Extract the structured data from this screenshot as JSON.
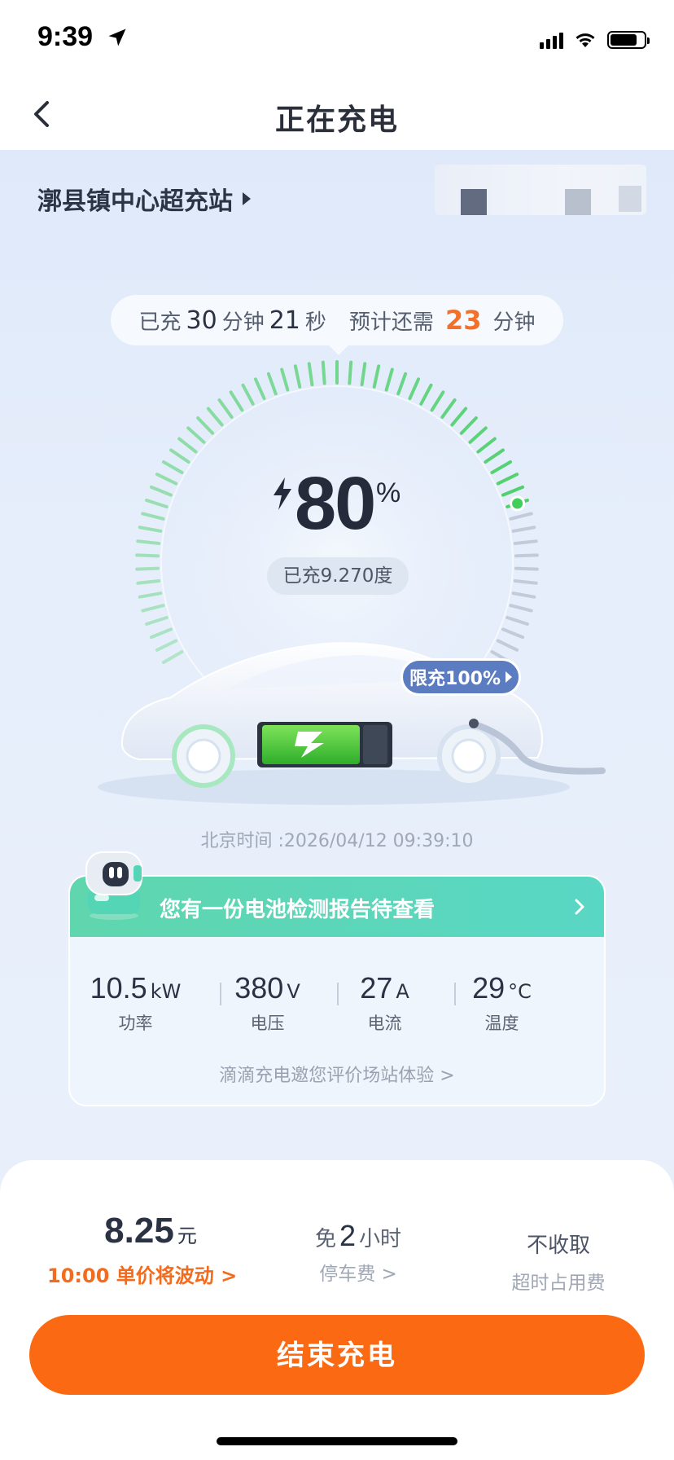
{
  "status_bar": {
    "time": "9:39",
    "icons": [
      "location-arrow-icon",
      "signal-icon",
      "wifi-icon",
      "battery-icon"
    ]
  },
  "nav": {
    "title": "正在充电",
    "back_icon": "chevron-left-icon"
  },
  "station": {
    "name": "漷县镇中心超充站"
  },
  "timer": {
    "prefix": "已充",
    "minutes": "30",
    "min_unit": "分钟",
    "seconds": "21",
    "sec_unit": "秒",
    "remaining_prefix": "预计还需",
    "remaining_minutes": "23",
    "remaining_unit": "分钟"
  },
  "gauge": {
    "percent": "80",
    "percent_sign": "%",
    "charged_energy": "已充9.270度",
    "limit_label": "限充100%",
    "progress_fraction": 0.8
  },
  "beijing_time": "北京时间 :2026/04/12 09:39:10",
  "battery_report": {
    "text": "您有一份电池检测报告待查看"
  },
  "metrics": [
    {
      "value": "10.5",
      "unit": "kW",
      "label": "功率"
    },
    {
      "value": "380",
      "unit": "V",
      "label": "电压"
    },
    {
      "value": "27",
      "unit": "A",
      "label": "电流"
    },
    {
      "value": "29",
      "unit": "°C",
      "label": "温度"
    }
  ],
  "card_footer": "滴滴充电邀您评价场站体验 >",
  "pricing": {
    "price": "8.25",
    "price_unit": "元",
    "price_note": "10:00 单价将波动 >",
    "parking_prefix": "免",
    "parking_hours": "2",
    "parking_unit": "小时",
    "parking_label": "停车费 >",
    "overtime_top": "不收取",
    "overtime_label": "超时占用费"
  },
  "end_button": "结束充电",
  "colors": {
    "accent_orange": "#fb6a12",
    "gauge_green": "#4fd06b",
    "report_teal": "#5fd6ad",
    "limit_blue": "#5b7cc0"
  }
}
